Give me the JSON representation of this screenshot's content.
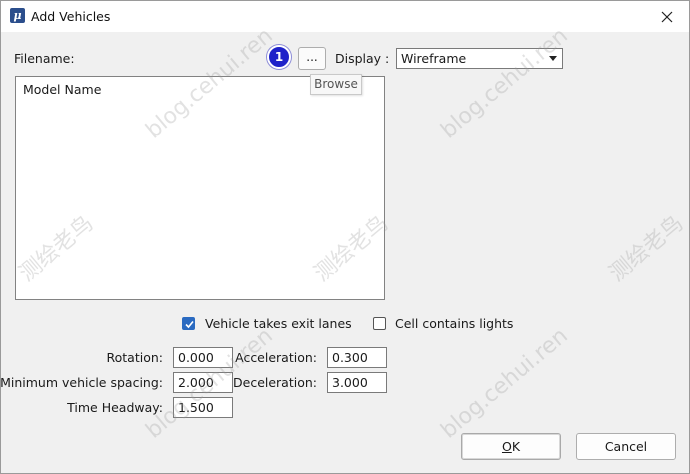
{
  "window": {
    "title": "Add Vehicles",
    "app_icon_glyph": "μ",
    "close_icon": "close-icon"
  },
  "filename": {
    "label": "Filename:",
    "browse_label": "...",
    "callout_number": "1",
    "tooltip": "Browse"
  },
  "display": {
    "label": "Display :",
    "selected": "Wireframe"
  },
  "model_list": {
    "header": "Model Name",
    "items": []
  },
  "options": {
    "exit_lanes": {
      "label": "Vehicle takes exit lanes",
      "checked": true
    },
    "cell_lights": {
      "label": "Cell contains lights",
      "checked": false
    }
  },
  "fields": {
    "rotation": {
      "label": "Rotation:",
      "value": "0.000"
    },
    "min_spacing": {
      "label": "Minimum vehicle spacing:",
      "value": "2.000"
    },
    "time_headway": {
      "label": "Time Headway:",
      "value": "1.500"
    },
    "acceleration": {
      "label": "Acceleration:",
      "value": "0.300"
    },
    "deceleration": {
      "label": "Deceleration:",
      "value": "3.000"
    }
  },
  "buttons": {
    "ok_mnemonic": "O",
    "ok_rest": "K",
    "cancel": "Cancel"
  },
  "watermarks": [
    "blog.cehui.ren",
    "测绘老鸟"
  ],
  "colors": {
    "callout": "#1f22c9",
    "checkbox_checked": "#2a6ac1"
  }
}
